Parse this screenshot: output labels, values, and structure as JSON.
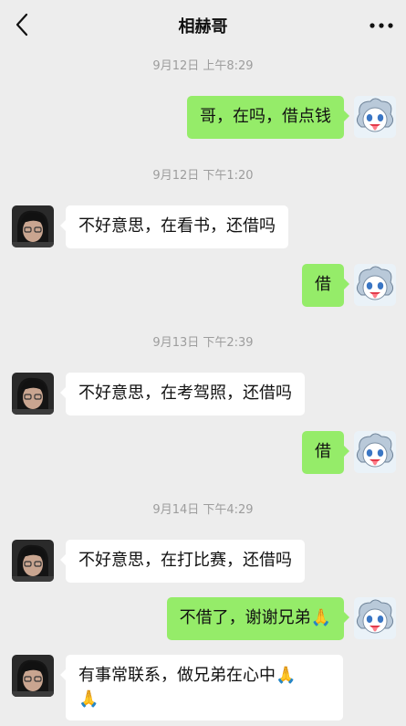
{
  "header": {
    "title": "相赫哥"
  },
  "timestamps": [
    "9月12日 上午8:29",
    "9月12日 下午1:20",
    "9月13日 下午2:39",
    "9月14日 下午4:29"
  ],
  "messages": [
    {
      "side": "out",
      "text": "哥，在吗，借点钱"
    },
    {
      "side": "in",
      "text": "不好意思，在看书，还借吗"
    },
    {
      "side": "out",
      "text": "借"
    },
    {
      "side": "in",
      "text": "不好意思，在考驾照，还借吗"
    },
    {
      "side": "out",
      "text": "借"
    },
    {
      "side": "in",
      "text": "不好意思，在打比赛，还借吗"
    },
    {
      "side": "out",
      "text": "不借了，谢谢兄弟",
      "emoji": "🙏"
    },
    {
      "side": "in",
      "text": "有事常联系，做兄弟在心中",
      "emoji": "🙏",
      "emoji2": "🙏"
    }
  ],
  "colors": {
    "background": "#ededed",
    "bubble_out": "#95ec69",
    "bubble_in": "#ffffff",
    "timestamp": "#9d9d9d"
  },
  "icons": {
    "back": "chevron-left-icon",
    "more": "more-dots-icon"
  }
}
